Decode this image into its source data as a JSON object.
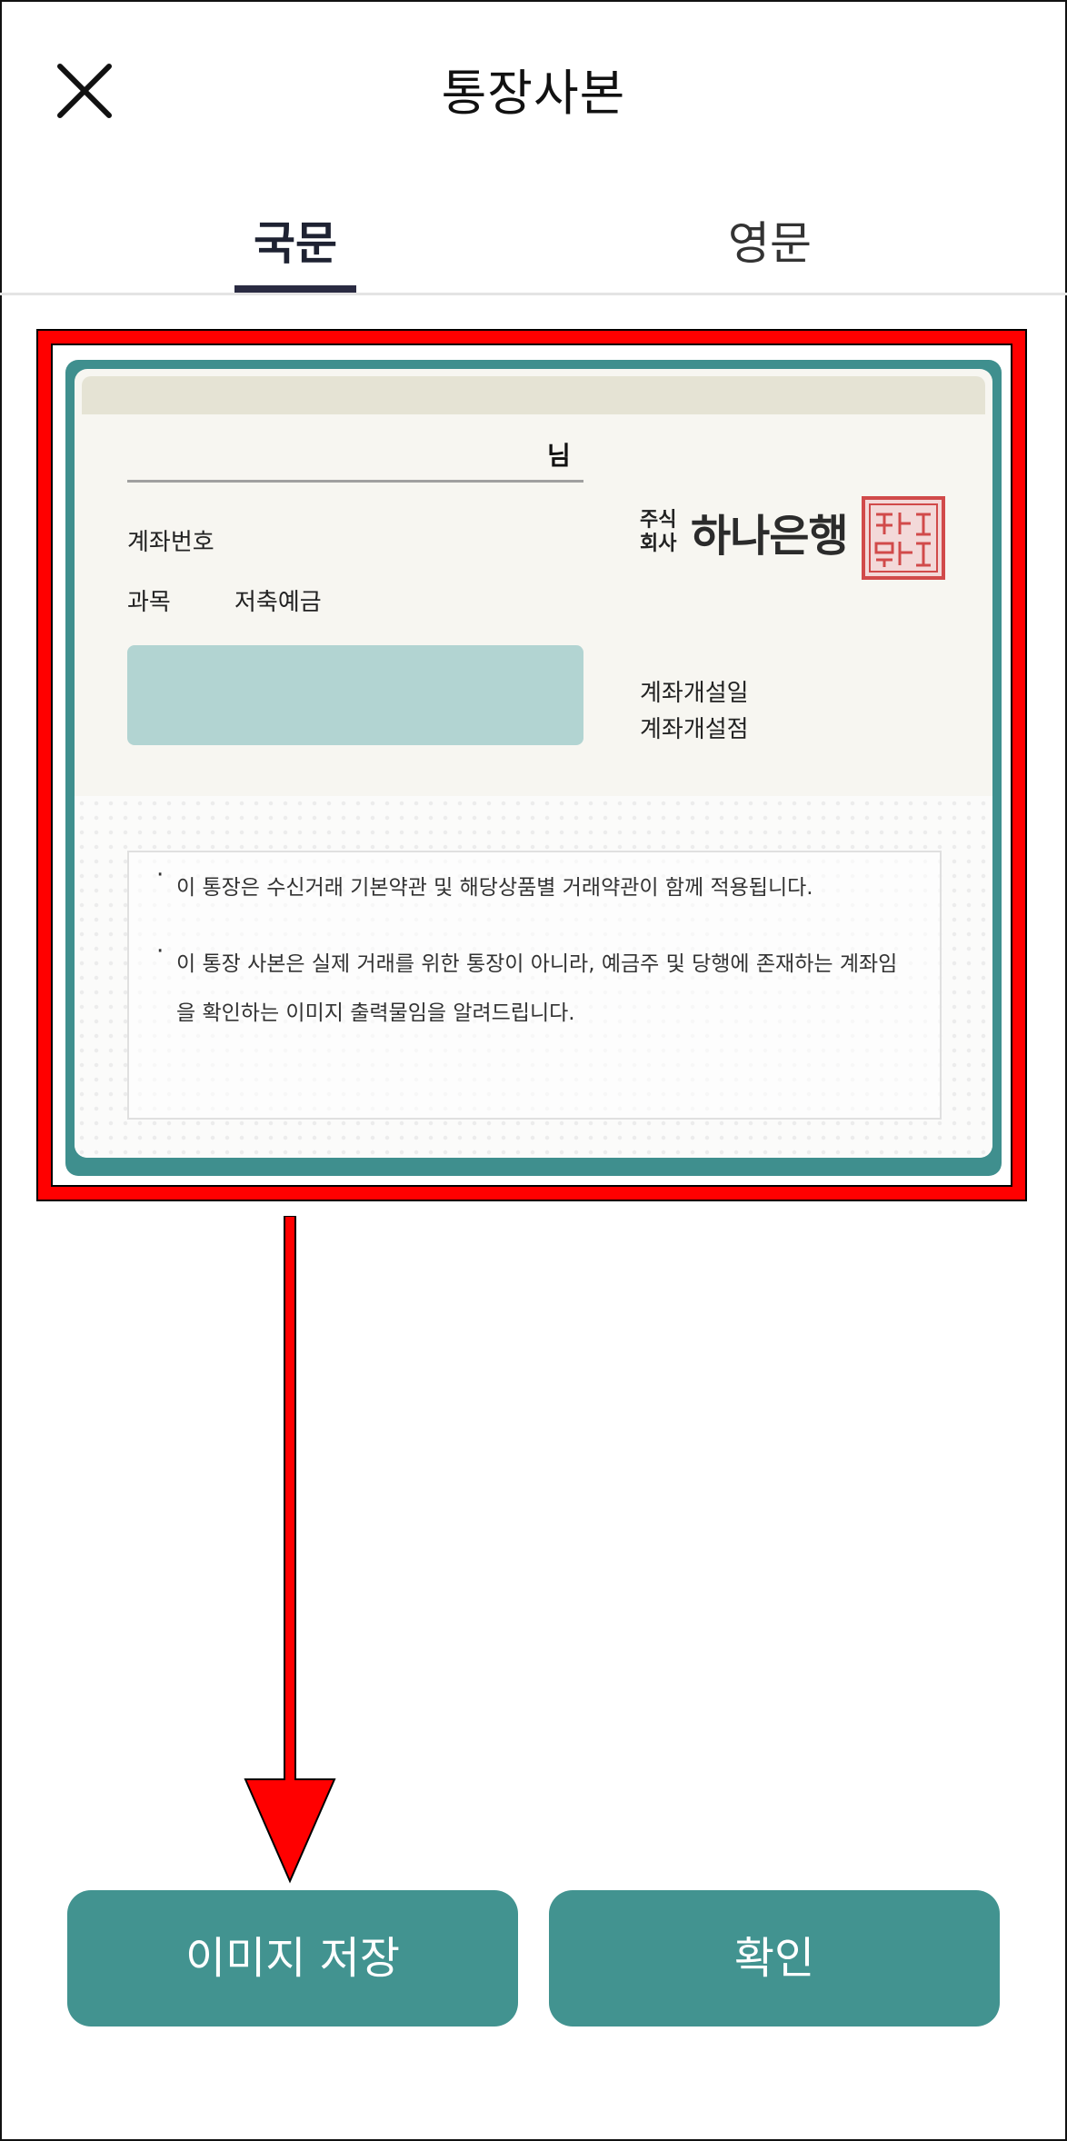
{
  "header": {
    "title": "통장사본",
    "close_icon": "close-icon"
  },
  "tabs": [
    {
      "label": "국문",
      "selected": true
    },
    {
      "label": "영문",
      "selected": false
    }
  ],
  "passbook": {
    "name_suffix": "님",
    "account_number_label": "계좌번호",
    "subject_label": "과목",
    "subject_value": "저축예금",
    "bank_corp_mark": "주식\n회사",
    "bank_name": "하나은행",
    "seal_icon": "bank-seal-icon",
    "open_date_label": "계좌개설일",
    "open_branch_label": "계좌개설점",
    "notices": [
      "이 통장은 수신거래 기본약관 및 해당상품별 거래약관이 함께 적용됩니다.",
      "이 통장 사본은 실제 거래를 위한 통장이 아니라, 예금주 및 당행에 존재하는 계좌임",
      "을 확인하는 이미지 출력물임을 알려드립니다."
    ],
    "bullet": "·"
  },
  "buttons": {
    "save_image": "이미지 저장",
    "confirm": "확인"
  },
  "colors": {
    "accent_teal": "#429390",
    "highlight_red": "#ff0000",
    "tab_underline": "#2a2b42"
  }
}
